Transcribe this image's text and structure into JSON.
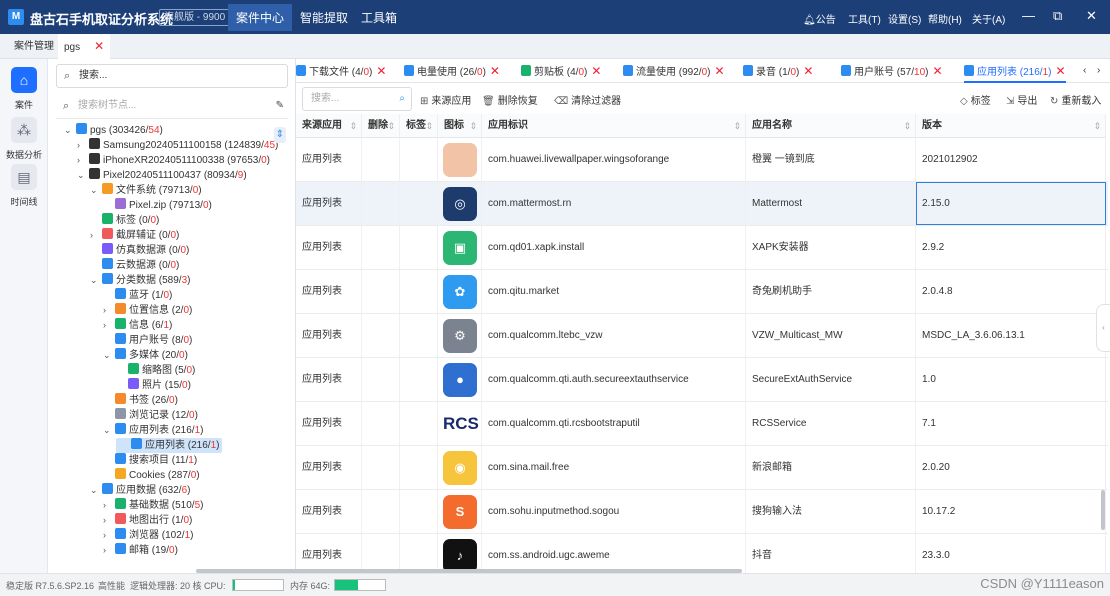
{
  "app": {
    "logo": "M",
    "name": "盘古石手机取证分析系统",
    "edition": "旗舰版 - 9900",
    "menu": [
      "案件中心",
      "智能提取",
      "工具箱"
    ],
    "right_menu": [
      "公告",
      "工具(T)",
      "设置(S)",
      "帮助(H)",
      "关于(A)"
    ],
    "window_buttons": [
      "—",
      "⧉",
      "✕"
    ]
  },
  "tabs": [
    {
      "label": "案件管理"
    },
    {
      "label": "pgs",
      "close": "✕"
    }
  ],
  "rail": [
    {
      "label": "案件",
      "icon": "home-icon"
    },
    {
      "label": "数据分析",
      "icon": "analytics-icon"
    },
    {
      "label": "时间线",
      "icon": "timeline-icon"
    }
  ],
  "tree": {
    "search_placeholder": "搜索...",
    "node_search_placeholder": "搜索树节点...",
    "nodes": [
      {
        "label": "pgs (303426/",
        "red": "54",
        "tail": ")",
        "indent": 0,
        "arrow": "⌄",
        "icon_color": "#2d8cf0"
      },
      {
        "label": "Samsung20240511100158 (124839/",
        "red": "45",
        "tail": ")",
        "indent": 1,
        "arrow": "›",
        "icon_color": "#333"
      },
      {
        "label": "iPhoneXR20240511100338 (97653/",
        "red": "0",
        "tail": ")",
        "indent": 1,
        "arrow": "›",
        "icon_color": "#333"
      },
      {
        "label": "Pixel20240511100437 (80934/",
        "red": "9",
        "tail": ")",
        "indent": 1,
        "arrow": "⌄",
        "icon_color": "#333"
      },
      {
        "label": "文件系统 (79713/",
        "red": "0",
        "tail": ")",
        "indent": 2,
        "arrow": "⌄",
        "icon_color": "#f59a23"
      },
      {
        "label": "Pixel.zip (79713/",
        "red": "0",
        "tail": ")",
        "indent": 3,
        "arrow": "",
        "icon_color": "#9b6bd6"
      },
      {
        "label": "标签 (0/",
        "red": "0",
        "tail": ")",
        "indent": 2,
        "arrow": "",
        "icon_color": "#19b26b"
      },
      {
        "label": "截屏辅证 (0/",
        "red": "0",
        "tail": ")",
        "indent": 2,
        "arrow": "›",
        "icon_color": "#f05a5a"
      },
      {
        "label": "仿真数据源 (0/",
        "red": "0",
        "tail": ")",
        "indent": 2,
        "arrow": "",
        "icon_color": "#7a5af8"
      },
      {
        "label": "云数据源 (0/",
        "red": "0",
        "tail": ")",
        "indent": 2,
        "arrow": "",
        "icon_color": "#2d8cf0"
      },
      {
        "label": "分类数据 (589/",
        "red": "3",
        "tail": ")",
        "indent": 2,
        "arrow": "⌄",
        "icon_color": "#2d8cf0"
      },
      {
        "label": "蓝牙 (1/",
        "red": "0",
        "tail": ")",
        "indent": 3,
        "arrow": "",
        "icon_color": "#2d8cf0"
      },
      {
        "label": "位置信息 (2/",
        "red": "0",
        "tail": ")",
        "indent": 3,
        "arrow": "›",
        "icon_color": "#f58a2a"
      },
      {
        "label": "信息 (6/",
        "red": "1",
        "tail": ")",
        "indent": 3,
        "arrow": "›",
        "icon_color": "#19b26b"
      },
      {
        "label": "用户账号 (8/",
        "red": "0",
        "tail": ")",
        "indent": 3,
        "arrow": "",
        "icon_color": "#2d8cf0"
      },
      {
        "label": "多媒体 (20/",
        "red": "0",
        "tail": ")",
        "indent": 3,
        "arrow": "⌄",
        "icon_color": "#2d8cf0"
      },
      {
        "label": "缩略图 (5/",
        "red": "0",
        "tail": ")",
        "indent": 4,
        "arrow": "",
        "icon_color": "#19b26b"
      },
      {
        "label": "照片 (15/",
        "red": "0",
        "tail": ")",
        "indent": 4,
        "arrow": "",
        "icon_color": "#7a5af8"
      },
      {
        "label": "书签 (26/",
        "red": "0",
        "tail": ")",
        "indent": 3,
        "arrow": "",
        "icon_color": "#f58a2a"
      },
      {
        "label": "浏览记录 (12/",
        "red": "0",
        "tail": ")",
        "indent": 3,
        "arrow": "",
        "icon_color": "#8c96a6"
      },
      {
        "label": "应用列表 (216/",
        "red": "1",
        "tail": ")",
        "indent": 3,
        "arrow": "⌄",
        "icon_color": "#2d8cf0"
      },
      {
        "label": "应用列表 (216/",
        "red": "1",
        "tail": ")",
        "indent": 4,
        "arrow": "",
        "icon_color": "#2d8cf0",
        "selected": true
      },
      {
        "label": "搜索项目 (11/",
        "red": "1",
        "tail": ")",
        "indent": 3,
        "arrow": "",
        "icon_color": "#2d8cf0"
      },
      {
        "label": "Cookies (287/",
        "red": "0",
        "tail": ")",
        "indent": 3,
        "arrow": "",
        "icon_color": "#f5a623"
      },
      {
        "label": "应用数据 (632/",
        "red": "6",
        "tail": ")",
        "indent": 2,
        "arrow": "⌄",
        "icon_color": "#2d8cf0"
      },
      {
        "label": "基础数据 (510/",
        "red": "5",
        "tail": ")",
        "indent": 3,
        "arrow": "›",
        "icon_color": "#19b26b"
      },
      {
        "label": "地图出行 (1/",
        "red": "0",
        "tail": ")",
        "indent": 3,
        "arrow": "›",
        "icon_color": "#f05a5a"
      },
      {
        "label": "浏览器 (102/",
        "red": "1",
        "tail": ")",
        "indent": 3,
        "arrow": "›",
        "icon_color": "#2d8cf0"
      },
      {
        "label": "邮箱 (19/",
        "red": "0",
        "tail": ")",
        "indent": 3,
        "arrow": "›",
        "icon_color": "#2d8cf0"
      }
    ]
  },
  "subtabs": [
    {
      "label": "下载文件 (4/",
      "red": "0",
      "tail": ")",
      "icon_color": "#2d8cf0"
    },
    {
      "label": "电量使用 (26/",
      "red": "0",
      "tail": ")",
      "icon_color": "#2d8cf0"
    },
    {
      "label": "剪贴板 (4/",
      "red": "0",
      "tail": ")",
      "icon_color": "#19b26b"
    },
    {
      "label": "流量使用 (992/",
      "red": "0",
      "tail": ")",
      "icon_color": "#2d8cf0"
    },
    {
      "label": "录音 (1/",
      "red": "0",
      "tail": ")",
      "icon_color": "#2d8cf0"
    },
    {
      "label": "用户账号 (57/",
      "red": "10",
      "tail": ")",
      "icon_color": "#2d8cf0"
    },
    {
      "label": "应用列表 (216/",
      "red": "1",
      "tail": ")",
      "icon_color": "#2d8cf0",
      "active": true
    }
  ],
  "subtab_nav": [
    "‹",
    "›"
  ],
  "toolbar": {
    "search_placeholder": "搜索...",
    "source_app": "来源应用",
    "delete_restore": "删除恢复",
    "clear_filter": "清除过滤器",
    "tag": "标签",
    "export": "导出",
    "reload": "重新载入"
  },
  "columns": [
    "来源应用",
    "删除",
    "标签",
    "图标",
    "应用标识",
    "应用名称",
    "版本"
  ],
  "rows": [
    {
      "source": "应用列表",
      "bundle": "com.huawei.livewallpaper.wingsoforange",
      "name": "橙翼 一镜到底",
      "version": "2021012902",
      "icon_color": "#f3c3a8",
      "glyph": ""
    },
    {
      "source": "应用列表",
      "bundle": "com.mattermost.rn",
      "name": "Mattermost",
      "version": "2.15.0",
      "icon_color": "#1e3b6e",
      "glyph": "◎",
      "selected": true
    },
    {
      "source": "应用列表",
      "bundle": "com.qd01.xapk.install",
      "name": "XAPK安装器",
      "version": "2.9.2",
      "icon_color": "#2bb673",
      "glyph": "▣"
    },
    {
      "source": "应用列表",
      "bundle": "com.qitu.market",
      "name": "奇兔刷机助手",
      "version": "2.0.4.8",
      "icon_color": "#2f9bf0",
      "glyph": "✿"
    },
    {
      "source": "应用列表",
      "bundle": "com.qualcomm.ltebc_vzw",
      "name": "VZW_Multicast_MW",
      "version": "MSDC_LA_3.6.06.13.1",
      "icon_color": "#7b8290",
      "glyph": "⚙"
    },
    {
      "source": "应用列表",
      "bundle": "com.qualcomm.qti.auth.secureextauthservice",
      "name": "SecureExtAuthService",
      "version": "1.0",
      "icon_color": "#2f6fcf",
      "glyph": "●"
    },
    {
      "source": "应用列表",
      "bundle": "com.qualcomm.qti.rcsbootstraputil",
      "name": "RCSService",
      "version": "7.1",
      "icon_color": "#ffffff",
      "glyph": "RCS"
    },
    {
      "source": "应用列表",
      "bundle": "com.sina.mail.free",
      "name": "新浪邮箱",
      "version": "2.0.20",
      "icon_color": "#f7c53b",
      "glyph": "◉"
    },
    {
      "source": "应用列表",
      "bundle": "com.sohu.inputmethod.sogou",
      "name": "搜狗输入法",
      "version": "10.17.2",
      "icon_color": "#f36b2d",
      "glyph": "S"
    },
    {
      "source": "应用列表",
      "bundle": "com.ss.android.ugc.aweme",
      "name": "抖音",
      "version": "23.3.0",
      "icon_color": "#111111",
      "glyph": "♪"
    }
  ],
  "status": {
    "version": "稳定版 R7.5.6.SP2.16",
    "perf": "高性能",
    "cpu_label": "逻辑处理器: 20 核 CPU:",
    "cpu_usage": 0.04,
    "mem_label": "内存 64G:",
    "mem_usage": 0.45,
    "watermark": "CSDN @Y1111eason"
  },
  "colors": {
    "accent": "#1e6fff",
    "title_bar": "#1c3f78",
    "count_red": "#e33"
  }
}
